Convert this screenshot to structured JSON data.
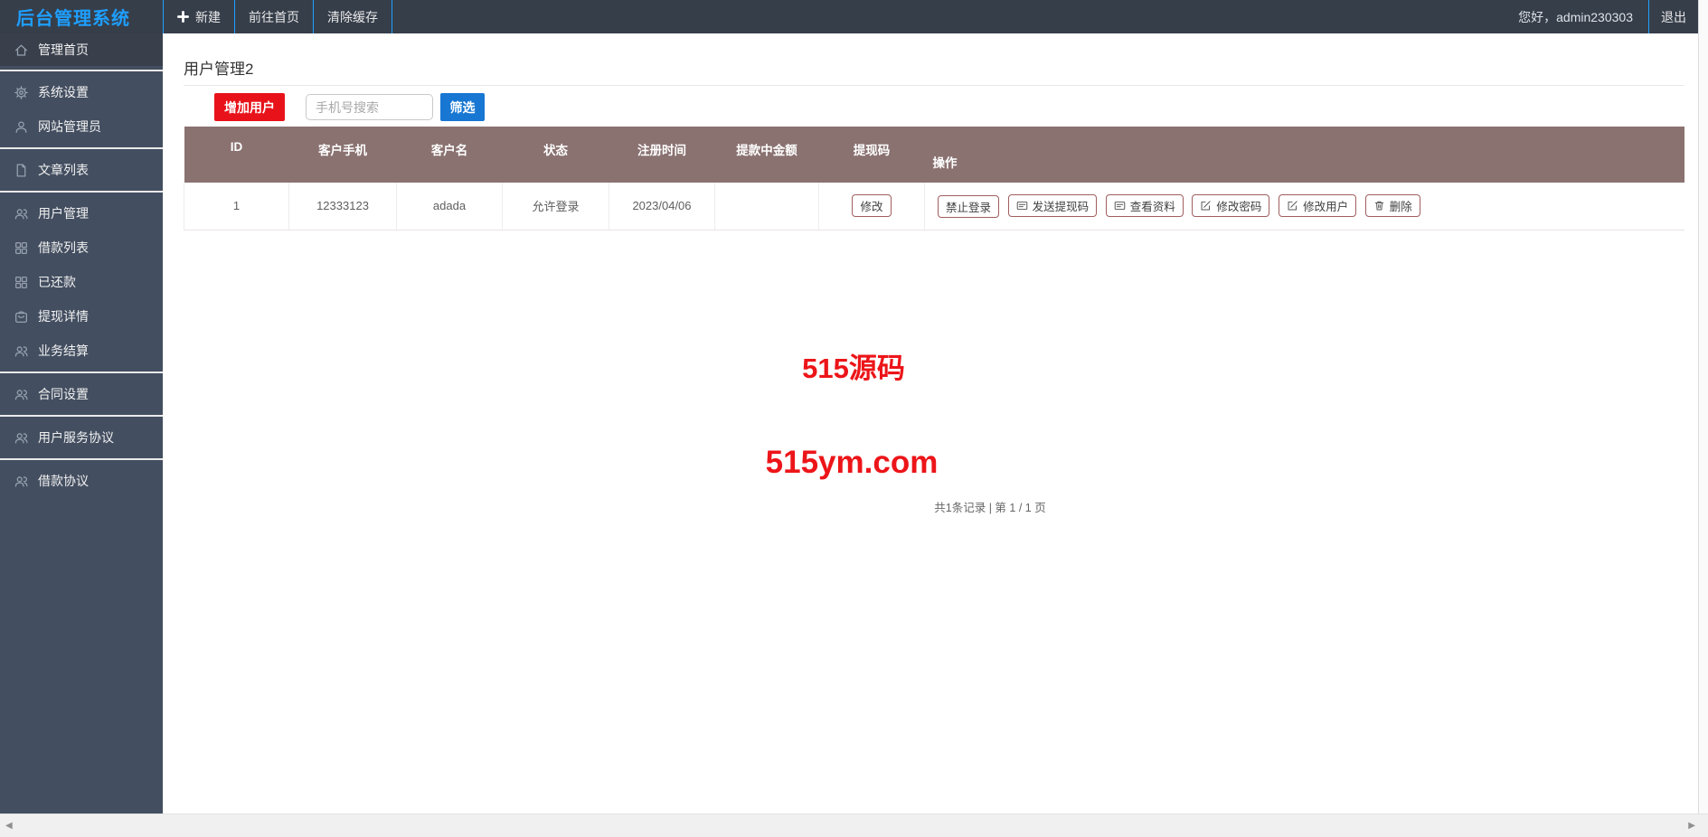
{
  "topbar": {
    "logo": "后台管理系统",
    "nav_new": "新建",
    "nav_home": "前往首页",
    "nav_clear_cache": "清除缓存",
    "greeting": "您好，admin230303",
    "logout": "退出"
  },
  "sidebar": {
    "items": [
      {
        "label": "管理首页",
        "icon": "home-icon",
        "active": true
      },
      {
        "label": "系统设置",
        "icon": "gear-icon",
        "active": false
      },
      {
        "label": "网站管理员",
        "icon": "user-icon",
        "active": false
      },
      {
        "label": "文章列表",
        "icon": "file-icon",
        "active": false
      },
      {
        "label": "用户管理",
        "icon": "users-icon",
        "active": false
      },
      {
        "label": "借款列表",
        "icon": "grid-icon",
        "active": false
      },
      {
        "label": "已还款",
        "icon": "grid-icon",
        "active": false
      },
      {
        "label": "提现详情",
        "icon": "bag-icon",
        "active": false
      },
      {
        "label": "业务结算",
        "icon": "users-icon",
        "active": false
      },
      {
        "label": "合同设置",
        "icon": "users-icon",
        "active": false
      },
      {
        "label": "用户服务协议",
        "icon": "users-icon",
        "active": false
      },
      {
        "label": "借款协议",
        "icon": "users-icon",
        "active": false
      }
    ]
  },
  "main": {
    "page_title": "用户管理2",
    "toolbar": {
      "add_user": "增加用户",
      "search_placeholder": "手机号搜索",
      "filter": "筛选"
    },
    "table": {
      "headers": [
        "ID",
        "客户手机",
        "客户名",
        "状态",
        "注册时间",
        "提款中金额",
        "提现码",
        "操作"
      ],
      "rows": [
        {
          "id": "1",
          "phone": "12333123",
          "name": "adada",
          "status": "允许登录",
          "registered": "2023/04/06",
          "withdrawing_amount": "",
          "withdraw_code_action": "修改",
          "actions": [
            "禁止登录",
            "发送提现码",
            "查看资料",
            "修改密码",
            "修改用户",
            "删除"
          ]
        }
      ]
    },
    "watermark_line1": "515源码",
    "watermark_line2": "515ym.com",
    "pagination": "共1条记录 | 第 1 / 1 页"
  },
  "colors": {
    "topbar_bg": "#363e4a",
    "sidebar_bg": "#434e60",
    "accent_blue": "#1E9FFF",
    "add_button_red": "#e8131a",
    "filter_button_blue": "#1777d3",
    "table_header_mauve": "#8a7271",
    "action_border_red": "#a15e5e",
    "watermark_red": "#ec1519"
  }
}
